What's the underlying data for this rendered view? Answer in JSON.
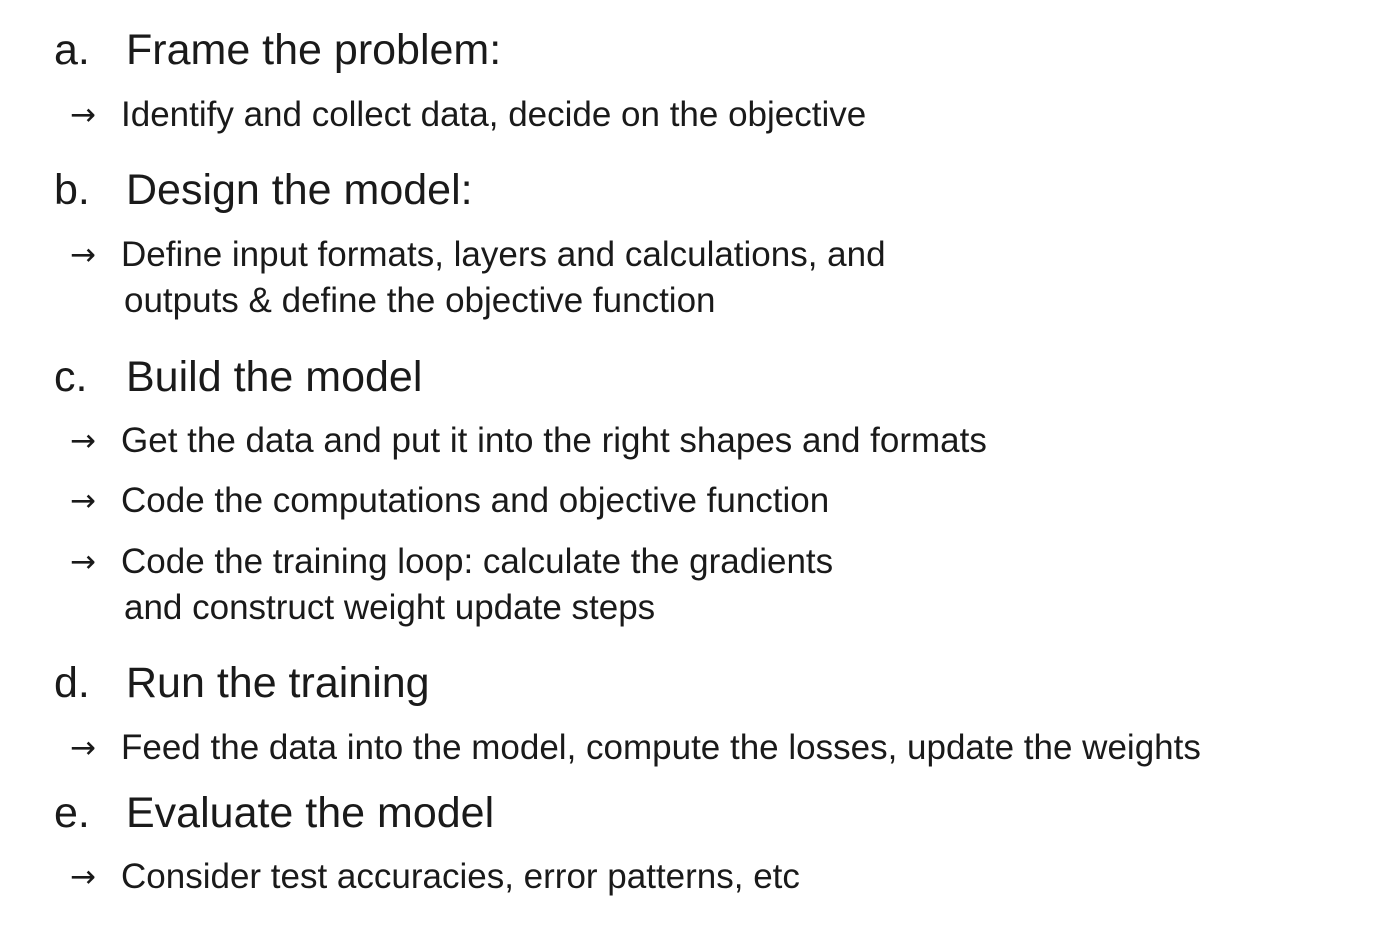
{
  "steps": [
    {
      "letter": "a.",
      "title": "Frame the problem:",
      "points": [
        {
          "arrow": "→",
          "lines": [
            "Identify and collect data, decide on the objective"
          ]
        }
      ]
    },
    {
      "letter": "b.",
      "title": "Design the model:",
      "points": [
        {
          "arrow": "→",
          "lines": [
            "Define input formats, layers and calculations, and",
            "outputs & define the objective function"
          ]
        }
      ]
    },
    {
      "letter": "c.",
      "title": "Build the model",
      "points": [
        {
          "arrow": "→",
          "lines": [
            "Get the data and put it into the right shapes and formats"
          ]
        },
        {
          "arrow": "→",
          "lines": [
            "Code the computations and objective function"
          ]
        },
        {
          "arrow": "→",
          "lines": [
            "Code the training loop: calculate the gradients",
            "and construct weight update steps"
          ]
        }
      ]
    },
    {
      "letter": "d.",
      "title": "Run the training",
      "points": [
        {
          "arrow": "→",
          "lines": [
            "Feed the data into the model, compute the losses, update the weights"
          ]
        }
      ]
    },
    {
      "letter": "e.",
      "title": "Evaluate the model",
      "points": [
        {
          "arrow": "→",
          "lines": [
            "Consider test accuracies, error patterns, etc"
          ]
        }
      ]
    }
  ]
}
